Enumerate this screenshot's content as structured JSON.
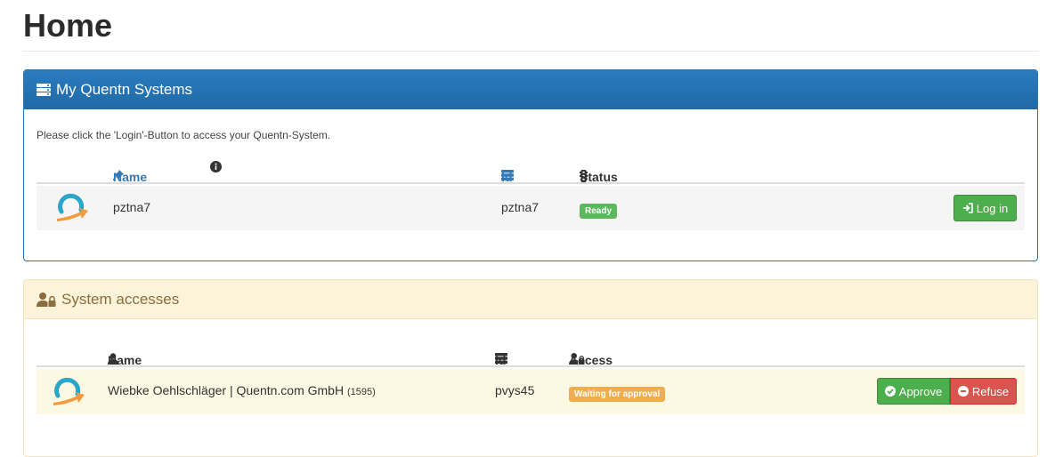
{
  "page": {
    "title": "Home"
  },
  "systems_panel": {
    "title": "My Quentn Systems",
    "intro": "Please click the 'Login'-Button to access your Quentn-System.",
    "columns": {
      "name": "Name",
      "id": "Id",
      "status": "Status"
    },
    "rows": [
      {
        "name": "pztna7",
        "id": "pztna7",
        "status": "Ready",
        "status_color": "#5cb85c",
        "button": "Log in"
      }
    ]
  },
  "access_panel": {
    "title": "System accesses",
    "columns": {
      "name": "Name",
      "id": "Id",
      "access": "Access"
    },
    "rows": [
      {
        "name": "Wiebke Oehlschläger | Quentn.com GmbH",
        "user_num": "(1595)",
        "id": "pvys45",
        "access": "Waiting for approval",
        "access_color": "#f0ad4e",
        "approve": "Approve",
        "refuse": "Refuse"
      }
    ]
  },
  "colors": {
    "primary": "#1f6aa6",
    "success": "#5cb85c",
    "danger": "#d9534f",
    "warning": "#f0ad4e"
  }
}
